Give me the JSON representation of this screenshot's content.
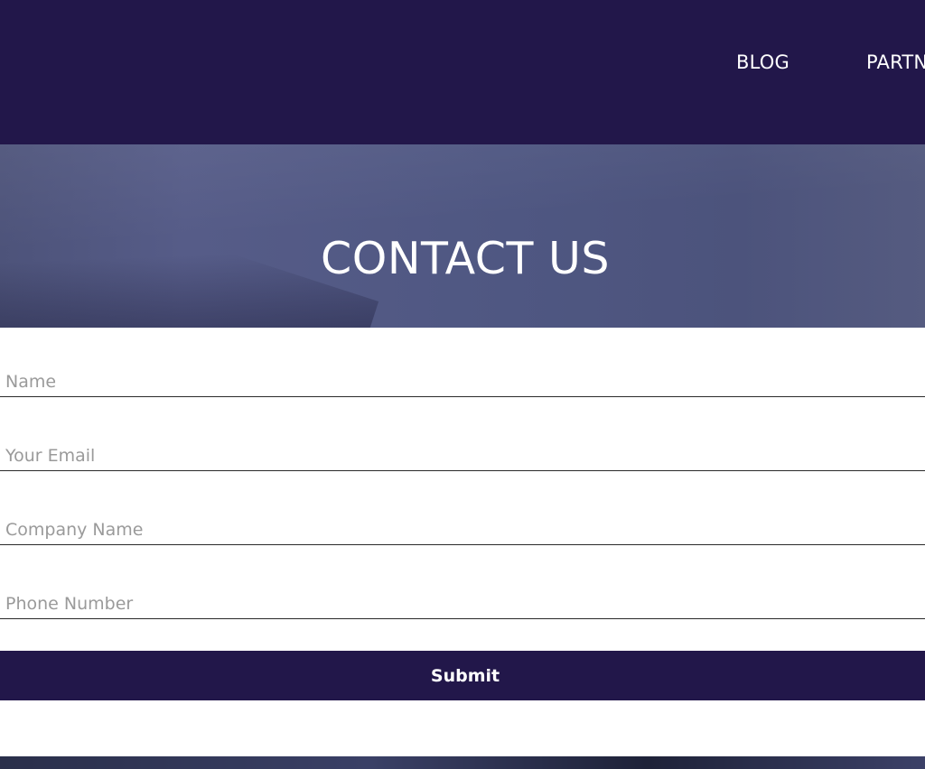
{
  "nav": {
    "items": [
      {
        "label": "BLOG"
      },
      {
        "label": "PARTNERS"
      }
    ]
  },
  "hero": {
    "title": "CONTACT US"
  },
  "form": {
    "name_placeholder": "Name",
    "email_placeholder": "Your Email",
    "company_placeholder": "Company Name",
    "phone_placeholder": "Phone Number",
    "submit_label": "Submit"
  },
  "colors": {
    "brand_dark": "#22174a",
    "hero_bg": "#505781",
    "placeholder": "#9a9a9a"
  }
}
